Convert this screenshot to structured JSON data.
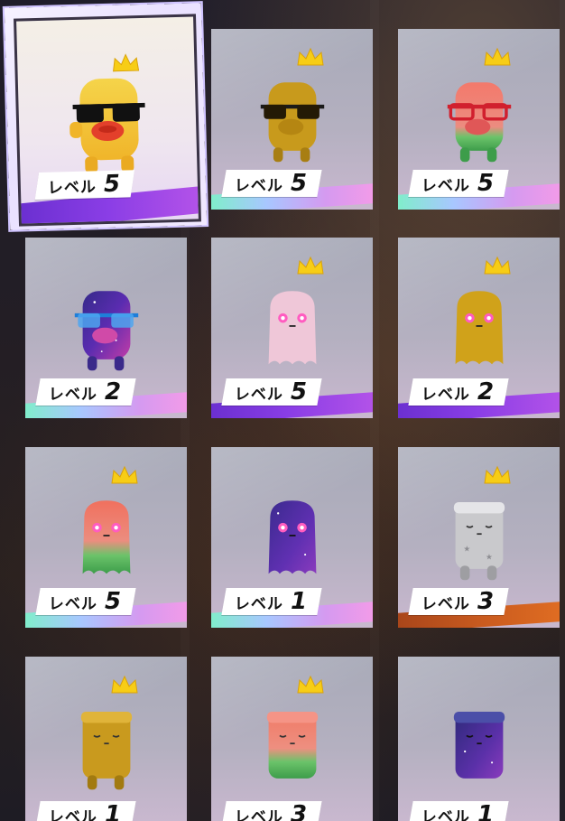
{
  "grid": {
    "items": [
      {
        "label": "レベル",
        "level": "5",
        "selected": true,
        "crown": true,
        "variant": "yellow-sunglasses"
      },
      {
        "label": "レベル",
        "level": "5",
        "selected": false,
        "crown": true,
        "variant": "gold-sunglasses"
      },
      {
        "label": "レベル",
        "level": "5",
        "selected": false,
        "crown": true,
        "variant": "watermelon-sunglasses"
      },
      {
        "label": "レベル",
        "level": "2",
        "selected": false,
        "crown": false,
        "variant": "galaxy-sunglasses"
      },
      {
        "label": "レベル",
        "level": "5",
        "selected": false,
        "crown": true,
        "variant": "pink-ghost"
      },
      {
        "label": "レベル",
        "level": "2",
        "selected": false,
        "crown": true,
        "variant": "gold-ghost"
      },
      {
        "label": "レベル",
        "level": "5",
        "selected": false,
        "crown": true,
        "variant": "watermelon-ghost"
      },
      {
        "label": "レベル",
        "level": "1",
        "selected": false,
        "crown": false,
        "variant": "galaxy-ghost"
      },
      {
        "label": "レベル",
        "level": "3",
        "selected": false,
        "crown": true,
        "variant": "silver-sleepy"
      },
      {
        "label": "レベル",
        "level": "1",
        "selected": false,
        "crown": true,
        "variant": "gold-sleepy"
      },
      {
        "label": "レベル",
        "level": "3",
        "selected": false,
        "crown": true,
        "variant": "watermelon-sleepy"
      },
      {
        "label": "レベル",
        "level": "1",
        "selected": false,
        "crown": false,
        "variant": "galaxy-sleepy"
      }
    ]
  },
  "colors": {
    "crown": "#f7cd16",
    "selected_frame": "#efe6ff",
    "rainbow_stripe": "#d59af0",
    "purple_stripe": "#8b3ee6",
    "orange_stripe": "#c85a1f"
  }
}
